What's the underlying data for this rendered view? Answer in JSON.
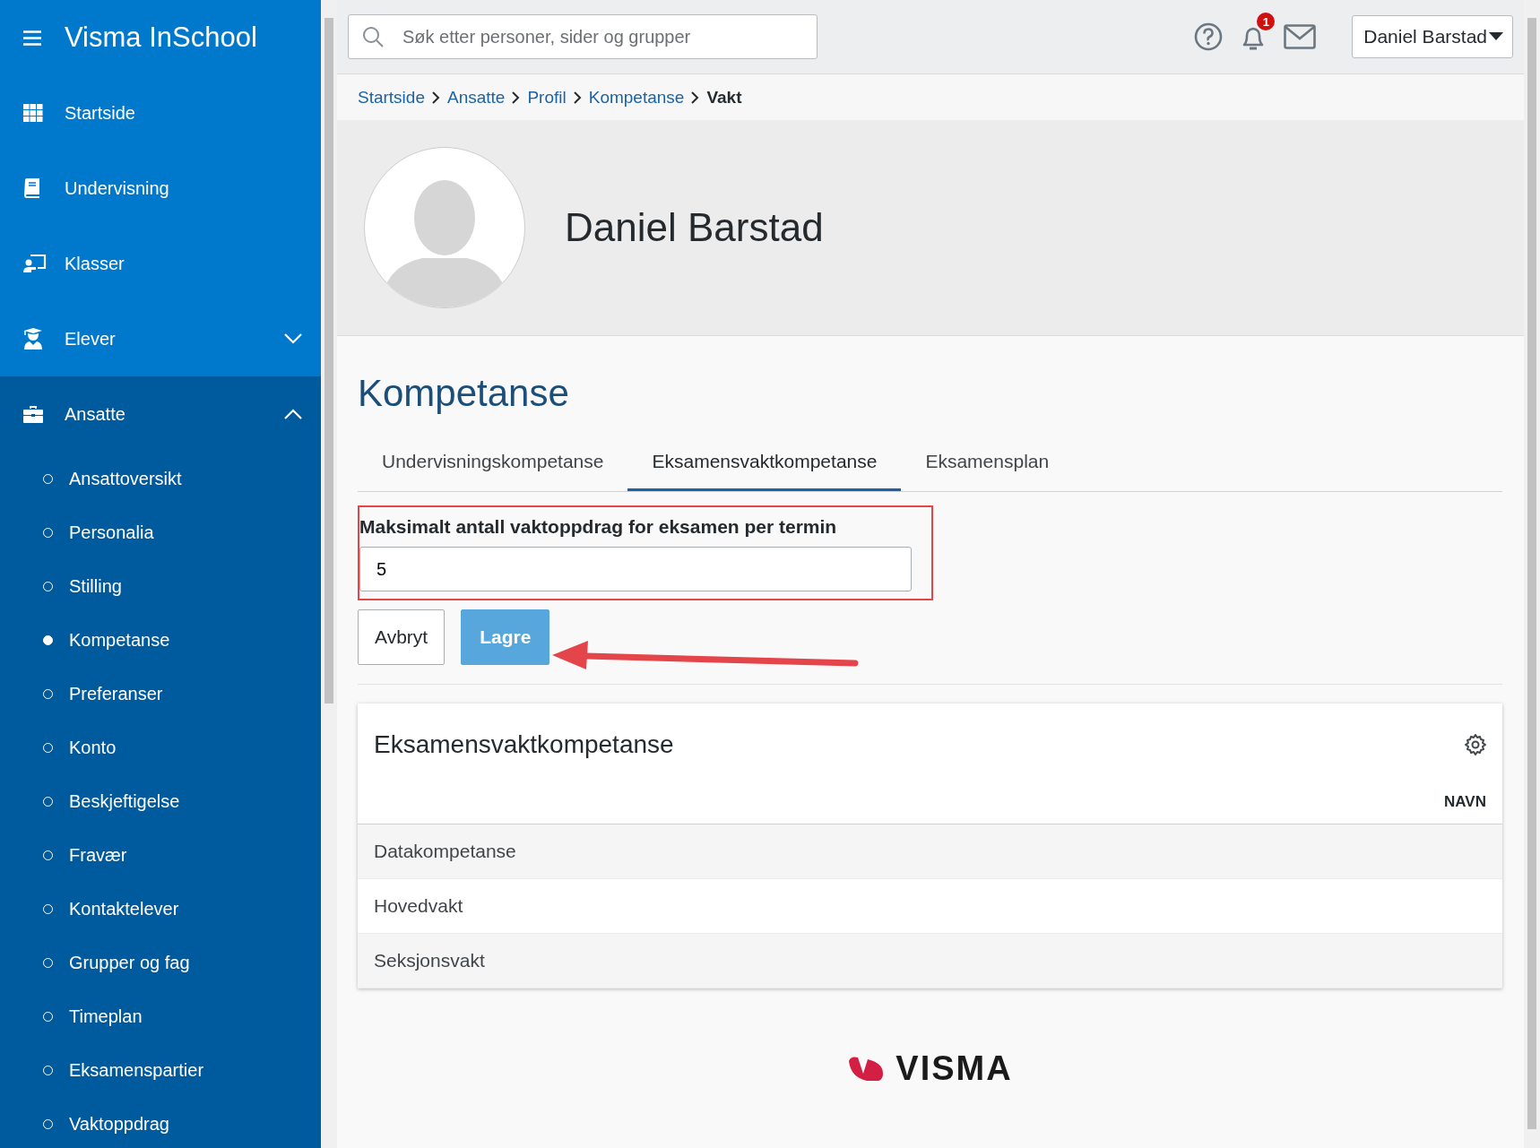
{
  "sidebar": {
    "title": "Visma InSchool",
    "items": [
      {
        "label": "Startside",
        "kind": "link"
      },
      {
        "label": "Undervisning",
        "kind": "link"
      },
      {
        "label": "Klasser",
        "kind": "link"
      },
      {
        "label": "Elever",
        "kind": "group",
        "expanded": false
      },
      {
        "label": "Ansatte",
        "kind": "group",
        "expanded": true,
        "children": [
          {
            "label": "Ansattoversikt",
            "selected": false
          },
          {
            "label": "Personalia",
            "selected": false
          },
          {
            "label": "Stilling",
            "selected": false
          },
          {
            "label": "Kompetanse",
            "selected": true
          },
          {
            "label": "Preferanser",
            "selected": false
          },
          {
            "label": "Konto",
            "selected": false
          },
          {
            "label": "Beskjeftigelse",
            "selected": false
          },
          {
            "label": "Fravær",
            "selected": false
          },
          {
            "label": "Kontaktelever",
            "selected": false
          },
          {
            "label": "Grupper og fag",
            "selected": false
          },
          {
            "label": "Timeplan",
            "selected": false
          },
          {
            "label": "Eksamenspartier",
            "selected": false
          },
          {
            "label": "Vaktoppdrag",
            "selected": false
          }
        ]
      }
    ]
  },
  "topbar": {
    "search": {
      "placeholder": "Søk etter personer, sider og grupper"
    },
    "notifications": "1",
    "user": "Daniel Barstad"
  },
  "breadcrumb": [
    "Startside",
    "Ansatte",
    "Profil",
    "Kompetanse",
    "Vakt"
  ],
  "profile": {
    "name": "Daniel Barstad"
  },
  "heading": "Kompetanse",
  "tabs": [
    {
      "label": "Undervisningskompetanse",
      "selected": false
    },
    {
      "label": "Eksamensvaktkompetanse",
      "selected": true
    },
    {
      "label": "Eksamensplan",
      "selected": false
    }
  ],
  "form": {
    "label": "Maksimalt antall vaktoppdrag for eksamen per termin",
    "value": "5",
    "buttons": [
      {
        "label": "Avbryt",
        "kind": "secondary"
      },
      {
        "label": "Lagre",
        "kind": "primary"
      }
    ]
  },
  "card": {
    "title": "Eksamensvaktkompetanse",
    "columns": [
      "NAVN"
    ],
    "rows": [
      "Datakompetanse",
      "Hovedvakt",
      "Seksjonsvakt"
    ]
  },
  "footer": {
    "logo": "VISMA"
  }
}
